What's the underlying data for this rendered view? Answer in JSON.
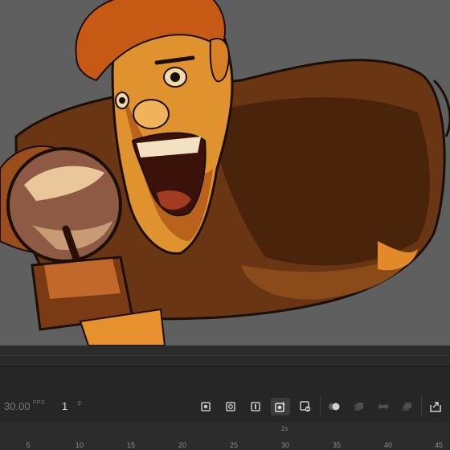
{
  "stage": {
    "artwork": "cartoon-villain-character-with-crystal-ball",
    "background_color": "#5f5f5f"
  },
  "timeline": {
    "fps_value": "30.00",
    "fps_unit": "FPS",
    "frame_value": "1",
    "frame_unit": "F",
    "buttons": [
      {
        "name": "insert-keyframe-icon",
        "active": false
      },
      {
        "name": "insert-blank-keyframe-icon",
        "active": false
      },
      {
        "name": "insert-frame-icon",
        "active": false
      },
      {
        "name": "auto-keyframe-icon",
        "active": true
      },
      {
        "name": "clear-keyframe-icon",
        "active": false
      },
      {
        "name": "onion-skin-icon",
        "active": false
      },
      {
        "name": "edit-multiple-frames-icon",
        "active": false
      },
      {
        "name": "loop-icon",
        "active": false
      },
      {
        "name": "copy-frames-icon",
        "active": false
      },
      {
        "name": "export-icon",
        "active": false
      }
    ],
    "ruler": {
      "time_marker": "1s",
      "ticks": [
        "5",
        "10",
        "15",
        "20",
        "25",
        "30",
        "35",
        "40",
        "45"
      ]
    }
  },
  "colors": {
    "panel": "#262626",
    "stage": "#5f5f5f",
    "accent_text": "#e6e6e6",
    "muted_text": "#7a7a7a"
  }
}
